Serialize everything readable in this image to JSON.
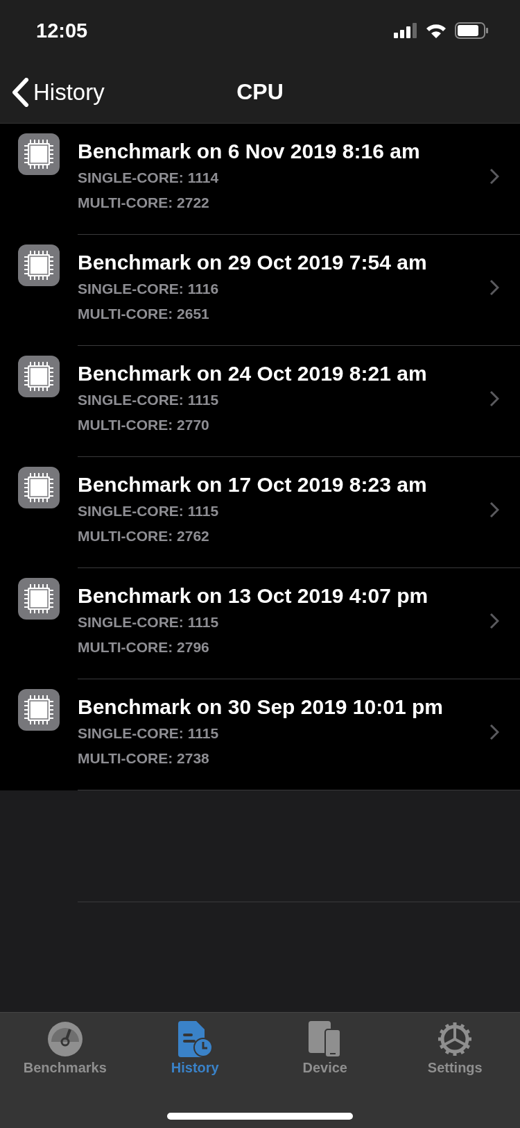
{
  "status_bar": {
    "time": "12:05"
  },
  "nav": {
    "back": "History",
    "title": "CPU"
  },
  "rows": [
    {
      "title": "Benchmark on 6 Nov 2019 8:16 am",
      "single": "SINGLE-CORE: 1114",
      "multi": "MULTI-CORE: 2722"
    },
    {
      "title": "Benchmark on 29 Oct 2019 7:54 am",
      "single": "SINGLE-CORE: 1116",
      "multi": "MULTI-CORE: 2651"
    },
    {
      "title": "Benchmark on 24 Oct 2019 8:21 am",
      "single": "SINGLE-CORE: 1115",
      "multi": "MULTI-CORE: 2770"
    },
    {
      "title": "Benchmark on 17 Oct 2019 8:23 am",
      "single": "SINGLE-CORE: 1115",
      "multi": "MULTI-CORE: 2762"
    },
    {
      "title": "Benchmark on 13 Oct 2019 4:07 pm",
      "single": "SINGLE-CORE: 1115",
      "multi": "MULTI-CORE: 2796"
    },
    {
      "title": "Benchmark on 30 Sep 2019 10:01 pm",
      "single": "SINGLE-CORE: 1115",
      "multi": "MULTI-CORE: 2738"
    }
  ],
  "tabs": [
    {
      "label": "Benchmarks",
      "kind": "gauge",
      "selected": false
    },
    {
      "label": "History",
      "kind": "document",
      "selected": true
    },
    {
      "label": "Device",
      "kind": "devices",
      "selected": false
    },
    {
      "label": "Settings",
      "kind": "gear",
      "selected": false
    }
  ]
}
